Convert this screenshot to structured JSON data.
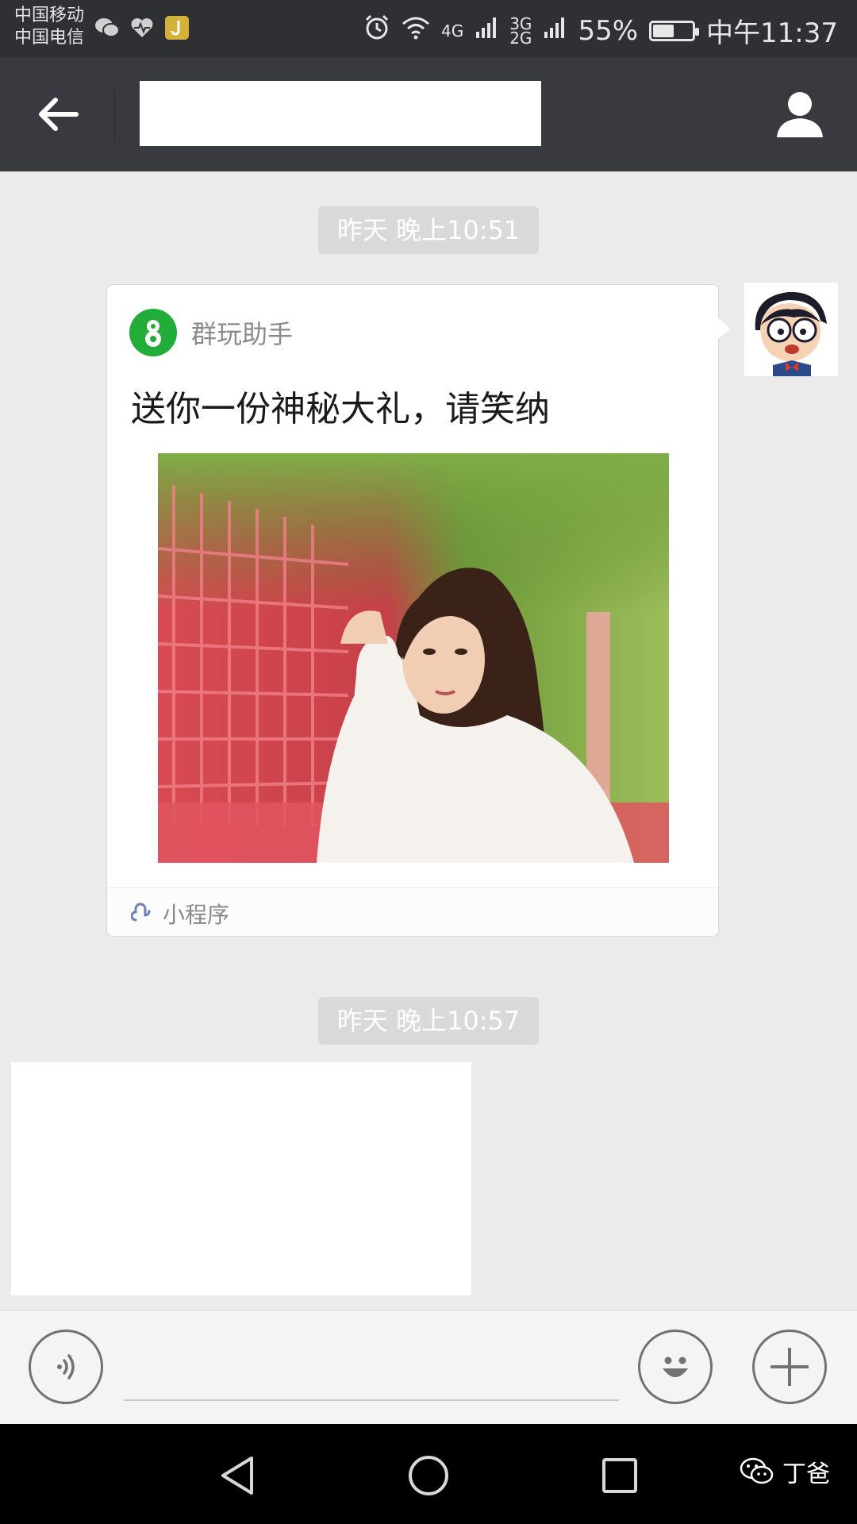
{
  "status_bar": {
    "carrier_1": "中国移动",
    "carrier_2": "中国电信",
    "net_4g": "4G",
    "net_3g": "3G",
    "net_2g": "2G",
    "battery": "55%",
    "battery_level": 0.55,
    "time": "中午11:37"
  },
  "chat": {
    "timestamp_1": "昨天 晚上10:51",
    "timestamp_2": "昨天 晚上10:57",
    "card": {
      "app_name": "群玩助手",
      "title": "送你一份神秘大礼，请笑纳",
      "footer": "小程序"
    }
  },
  "watermark": {
    "label": "丁爸"
  },
  "colors": {
    "nav_bg": "#393a3f",
    "status_bg": "#2f3033",
    "chat_bg": "#ebebeb",
    "app_green": "#22ac38"
  },
  "icons": {
    "back": "arrow-left-icon",
    "profile": "person-icon",
    "voice": "voice-icon",
    "emoji": "smiley-icon",
    "plus": "plus-icon"
  }
}
